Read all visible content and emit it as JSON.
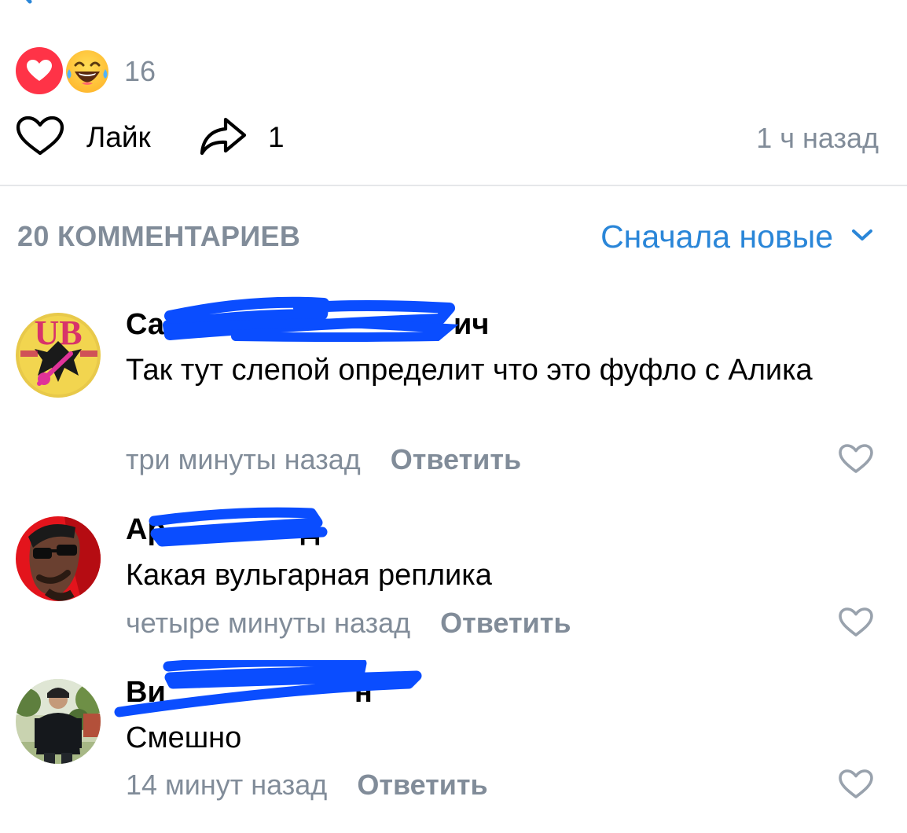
{
  "colors": {
    "accent": "#2a86d8",
    "secondary_text": "#818c99",
    "heart_reaction": "#ff3347",
    "laugh_reaction": "#ffcc33",
    "redaction_scribble": "#0a4dff"
  },
  "post": {
    "reactions": {
      "icons": [
        "heart-reaction-icon",
        "laugh-tears-reaction-icon"
      ],
      "count": "16"
    },
    "actions": {
      "like_label": "Лайк",
      "share_count": "1",
      "time": "1 ч назад"
    }
  },
  "comments_section": {
    "count_label": "20 КОММЕНТАРИЕВ",
    "sort_label": "Сначала новые"
  },
  "comments": [
    {
      "author_visible_start": "Са",
      "author_visible_end": "ич",
      "text": "Так тут слепой определит что это фуфло с Алика",
      "time": "три минуты назад",
      "reply_label": "Ответить"
    },
    {
      "author_visible_start": "Ар",
      "author_visible_end": "д",
      "text": "Какая вульгарная реплика",
      "time": "четыре минуты назад",
      "reply_label": "Ответить"
    },
    {
      "author_visible_start": "Ви",
      "author_visible_end": "н",
      "text": "Смешно",
      "time": "14 минут назад",
      "reply_label": "Ответить"
    }
  ]
}
